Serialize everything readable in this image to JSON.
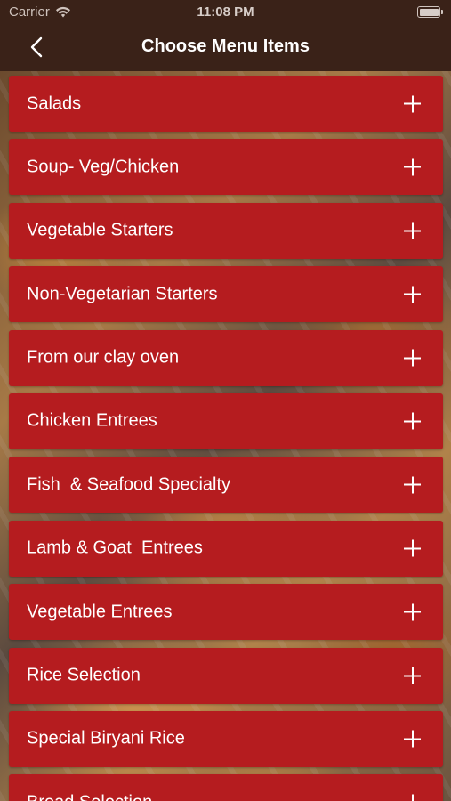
{
  "status_bar": {
    "carrier": "Carrier",
    "time": "11:08 PM",
    "wifi_icon": "wifi-icon",
    "battery_icon": "battery-icon"
  },
  "nav": {
    "back_icon": "chevron-left-icon",
    "title": "Choose Menu Items"
  },
  "menu": {
    "items": [
      {
        "label": "Salads"
      },
      {
        "label": "Soup- Veg/Chicken"
      },
      {
        "label": "Vegetable Starters"
      },
      {
        "label": "Non-Vegetarian Starters"
      },
      {
        "label": "From our clay oven"
      },
      {
        "label": "Chicken Entrees"
      },
      {
        "label": "Fish  & Seafood Specialty"
      },
      {
        "label": "Lamb & Goat  Entrees"
      },
      {
        "label": "Vegetable Entrees"
      },
      {
        "label": "Rice Selection"
      },
      {
        "label": "Special Biryani Rice"
      },
      {
        "label": "Bread Selection"
      }
    ],
    "expand_icon": "plus-icon"
  },
  "colors": {
    "nav_background": "#3a2218",
    "item_background": "#b51c1f",
    "text": "#ffffff"
  }
}
